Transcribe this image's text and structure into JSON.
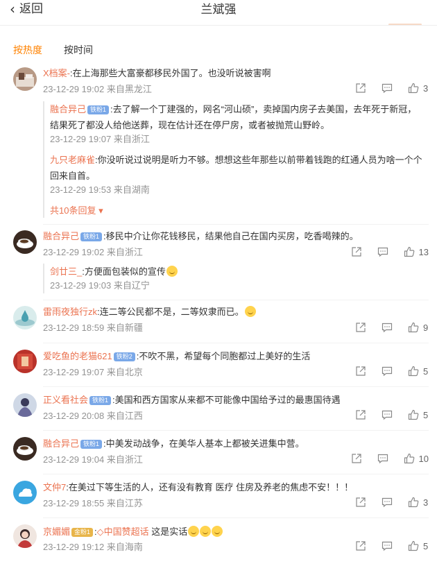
{
  "header": {
    "back_label": "返回",
    "title": "兰斌强"
  },
  "sort_tabs": [
    {
      "label": "按热度",
      "active": true
    },
    {
      "label": "按时间",
      "active": false
    }
  ],
  "colors": {
    "accent": "#ff8200",
    "name": "#eb7350",
    "meta": "#939393",
    "badge": "#7aa8e8"
  },
  "comments": [
    {
      "name": "X档案-",
      "text": ":在上海那些大富豪都移民外国了。也没听说被害啊",
      "time": "23-12-29 19:02",
      "location": "来自黑龙江",
      "likes": "3",
      "replies": [
        {
          "name": "融合异己",
          "badge": "铁粉1",
          "text": ":去了解一个丁建强的，网名“河山硕”，卖掉国内房子去美国，去年死于新冠，",
          "text2": "结果死了都没人给他送葬，现在估计还在停尸房，或者被抛荒山野岭。",
          "time": "23-12-29 19:07",
          "location": "来自浙江"
        },
        {
          "name": "九只老麻雀",
          "text": ":你没听说过说明是听力不够。想想这些年那些以前带着钱跑的红通人员为啥一个个",
          "text2": "回来自首。",
          "time": "23-12-29 19:53",
          "location": "来自湖南"
        }
      ],
      "more_replies": "共10条回复"
    },
    {
      "name": "融合异己",
      "badge": "铁粉1",
      "text": ":移民中介让你花钱移民，结果他自己在国内买房，吃香喝辣的。",
      "time": "23-12-29 19:02",
      "location": "来自浙江",
      "likes": "13",
      "replies": [
        {
          "name": "剑廿三_",
          "text": ":方便面包装似的宣传",
          "time": "23-12-29 19:03",
          "location": "来自辽宁"
        }
      ]
    },
    {
      "name": "雷雨夜独行zk",
      "text": ":连二等公民都不是，二等奴隶而已。",
      "time": "23-12-29 18:59",
      "location": "来自新疆",
      "likes": "9"
    },
    {
      "name": "爱吃鱼的老猫621",
      "badge": "铁粉2",
      "text": ":不吹不黑，希望每个同胞都过上美好的生活",
      "time": "23-12-29 19:07",
      "location": "来自北京",
      "likes": "5"
    },
    {
      "name": "正义看社会",
      "badge": "铁粉1",
      "text": ":美国和西方国家从来都不可能像中国给予过的最惠国待遇",
      "time": "23-12-29 20:08",
      "location": "来自江西",
      "likes": "5"
    },
    {
      "name": "融合异己",
      "badge": "铁粉1",
      "text": ":中美发动战争，在美华人基本上都被关进集中营。",
      "time": "23-12-29 19:04",
      "location": "来自浙江",
      "likes": "10"
    },
    {
      "name": "文仲7",
      "text": ":在美过下等生活的人，还有没有教育 医疗 住房及养老的焦虑不安！！！",
      "time": "23-12-29 18:55",
      "location": "来自江苏",
      "likes": "3"
    },
    {
      "name": "京媚媚",
      "badge": "金粉1",
      "supertopic": "中国赞超话",
      "text": " 这是实话",
      "time": "23-12-29 19:12",
      "location": "来自海南",
      "likes": "5"
    }
  ]
}
